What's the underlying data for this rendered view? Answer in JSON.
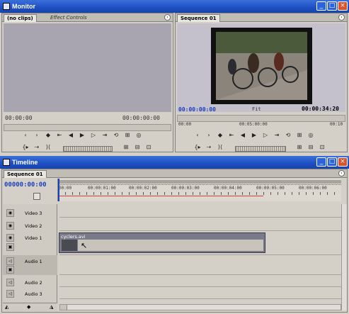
{
  "monitor": {
    "title": "Monitor",
    "tabs": {
      "source": "(no clips)",
      "effect_controls": "Effect Controls",
      "program": "Sequence 01"
    },
    "source_timecode_left": "00:00:00",
    "source_timecode_right": "00:00:00:00",
    "program_timecode_current": "00:00:00:00",
    "program_fit": "Fit",
    "program_timecode_duration": "00:00:34:20",
    "program_ruler_mid": "00:05:00:00",
    "program_ruler_left": "00:00",
    "program_ruler_right": "00:10"
  },
  "timeline": {
    "title": "Timeline",
    "tab": "Sequence 01",
    "timecode": "00000:00:00",
    "ruler_labels": [
      "00:00",
      "00:00:01:00",
      "00:00:02:00",
      "00:00:03:00",
      "00:00:04:00",
      "00:00:05:00",
      "00:00:06:00"
    ],
    "tracks": [
      {
        "name": "Video 3"
      },
      {
        "name": "Video 2"
      },
      {
        "name": "Video 1"
      },
      {
        "name": "Audio 1"
      },
      {
        "name": "Audio 2"
      },
      {
        "name": "Audio 3"
      }
    ],
    "clip_name": "cyclers.avi"
  },
  "window_buttons": {
    "minimize": "_",
    "maximize": "□",
    "close": "×"
  },
  "icons": [
    "app-icon",
    "menu-icon",
    "eye-icon",
    "speaker-icon",
    "lock-icon",
    "play-icon",
    "step-back-icon",
    "step-forward-icon",
    "mark-in-icon",
    "mark-out-icon",
    "loop-icon",
    "safe-margins-icon",
    "export-frame-icon",
    "cursor-icon"
  ],
  "colors": {
    "titlebar": "#1d4fc4",
    "timecode_blue": "#1a3fc0",
    "panel_bg": "#d4d0c8",
    "monitor_gray": "#a8a4b0"
  }
}
